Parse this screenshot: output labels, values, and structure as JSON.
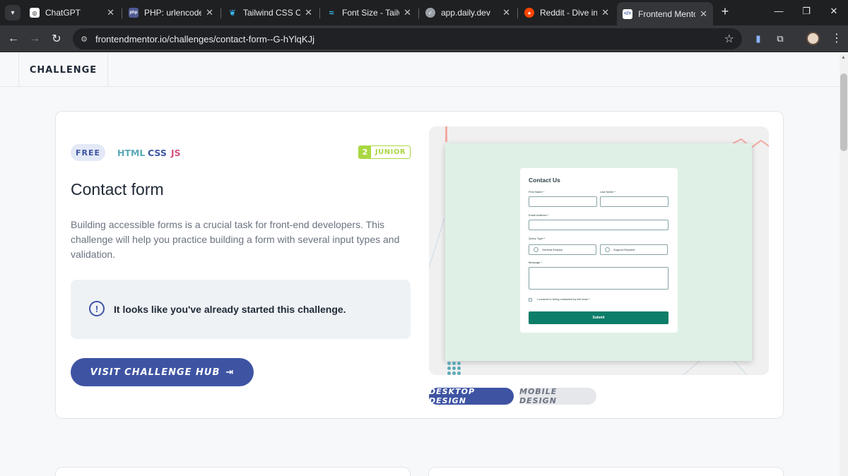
{
  "browser": {
    "tabs": [
      {
        "title": "ChatGPT",
        "close": "✕"
      },
      {
        "title": "PHP: urlencode -",
        "close": "✕"
      },
      {
        "title": "Tailwind CSS Che",
        "close": "✕"
      },
      {
        "title": "Font Size - Tailwi",
        "close": "✕"
      },
      {
        "title": "app.daily.dev",
        "close": "✕"
      },
      {
        "title": "Reddit - Dive into",
        "close": "✕"
      },
      {
        "title": "Frontend Mentor",
        "close": "✕"
      }
    ],
    "active_tab_index": 6,
    "url": "frontendmentor.io/challenges/contact-form--G-hYlqKJj"
  },
  "page": {
    "subnav_label": "CHALLENGE",
    "challenge": {
      "badge": "FREE",
      "languages": [
        {
          "name": "HTML",
          "color": "#5ba9b8"
        },
        {
          "name": "CSS",
          "color": "#3e54a3"
        },
        {
          "name": "JS",
          "color": "#d2537b"
        }
      ],
      "level_number": "2",
      "level_name": "JUNIOR",
      "title": "Contact form",
      "description": "Building accessible forms is a crucial task for front-end developers. This challenge will help you practice building a form with several input types and validation.",
      "notice": "It looks like you've already started this challenge.",
      "hub_button": "VISIT CHALLENGE HUB"
    },
    "preview": {
      "form_title": "Contact Us",
      "first_name": "First Name *",
      "last_name": "Last Name *",
      "email": "Email Address *",
      "query_type": "Query Type *",
      "query_options": [
        "General Enquiry",
        "Support Request"
      ],
      "message": "Message *",
      "consent": "I consent to being contacted by the team *",
      "submit": "Submit"
    },
    "design_tabs": [
      "DESKTOP DESIGN",
      "MOBILE DESIGN"
    ]
  },
  "colors": {
    "brand_blue": "#3e54a3",
    "junior_green": "#aad742",
    "submit_green": "#0c7d69"
  }
}
